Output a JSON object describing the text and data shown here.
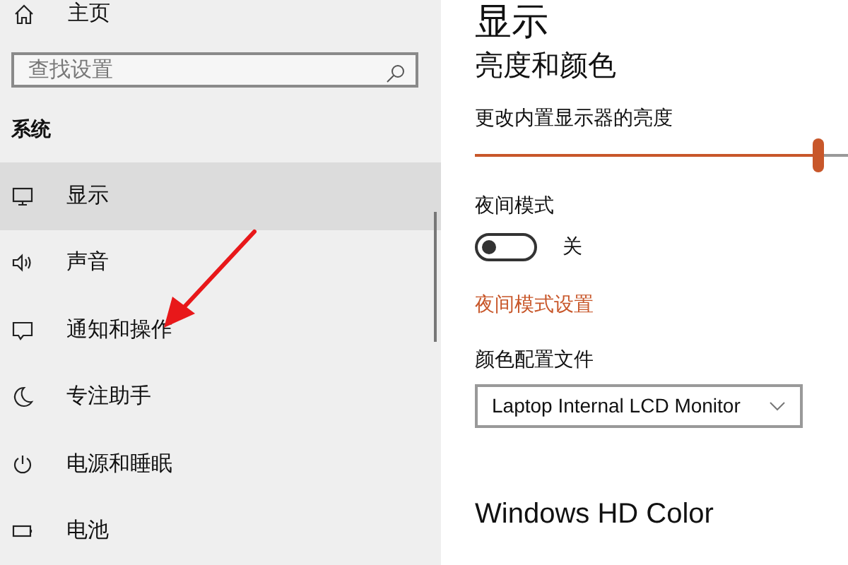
{
  "sidebar": {
    "home": "主页",
    "search": {
      "placeholder": "查找设置"
    },
    "section": "系统",
    "items": [
      {
        "label": "显示",
        "kind": "monitor",
        "selected": true
      },
      {
        "label": "声音",
        "kind": "speaker",
        "selected": false
      },
      {
        "label": "通知和操作",
        "kind": "message",
        "selected": false
      },
      {
        "label": "专注助手",
        "kind": "moon",
        "selected": false
      },
      {
        "label": "电源和睡眠",
        "kind": "power",
        "selected": false
      },
      {
        "label": "电池",
        "kind": "battery",
        "selected": false
      }
    ]
  },
  "content": {
    "title": "显示",
    "section": "亮度和颜色",
    "brightness": {
      "label": "更改内置显示器的亮度",
      "level": 0.92
    },
    "night_mode": {
      "label": "夜间模式",
      "on": false,
      "state_text": "关"
    },
    "night_link": "夜间模式设置",
    "color_profile": {
      "label": "颜色配置文件",
      "value": "Laptop Internal LCD Monitor"
    },
    "hd_color": "Windows HD Color"
  }
}
